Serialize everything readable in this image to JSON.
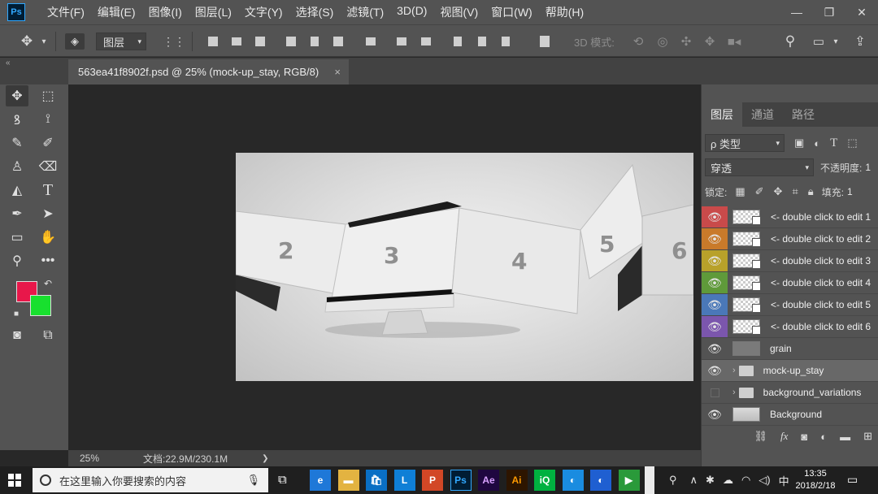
{
  "app": {
    "logo": "Ps"
  },
  "menu": [
    "文件(F)",
    "编辑(E)",
    "图像(I)",
    "图层(L)",
    "文字(Y)",
    "选择(S)",
    "滤镜(T)",
    "3D(D)",
    "视图(V)",
    "窗口(W)",
    "帮助(H)"
  ],
  "window_controls": {
    "minimize": "—",
    "restore": "❐",
    "close": "✕"
  },
  "options": {
    "auto_select_value": "图层",
    "mode_3d_label": "3D 模式:"
  },
  "document_tab": {
    "title": "563ea41f8902f.psd @ 25% (mock-up_stay, RGB/8)",
    "close": "×"
  },
  "colors": {
    "foreground": "#e8174a",
    "background": "#18e02e",
    "accent_selected_layer": "#686868"
  },
  "canvas": {
    "screens": [
      "2",
      "3",
      "4",
      "5",
      "6"
    ]
  },
  "status": {
    "zoom": "25%",
    "doc_size": "文档:22.9M/230.1M",
    "arrow": "❯"
  },
  "panel": {
    "tabs": [
      "图层",
      "通道",
      "路径"
    ],
    "filter_kind": "ρ 类型",
    "blend_mode": "穿透",
    "opacity_label": "不透明度:",
    "opacity_value": "1",
    "lock_label": "锁定:",
    "fill_label": "填充:",
    "fill_value": "1",
    "layers": [
      {
        "name": "<- double click to edit 1",
        "color": "#c94a4a",
        "thumb": "checker",
        "smart": true
      },
      {
        "name": "<- double click to edit 2",
        "color": "#c97a2a",
        "thumb": "checker",
        "smart": true
      },
      {
        "name": "<- double click to edit 3",
        "color": "#b8a12a",
        "thumb": "checker",
        "smart": true
      },
      {
        "name": "<- double click to edit 4",
        "color": "#5f9a3a",
        "thumb": "checker",
        "smart": true
      },
      {
        "name": "<- double click to edit 5",
        "color": "#4a78b8",
        "thumb": "checker",
        "smart": true
      },
      {
        "name": "<- double click to edit 6",
        "color": "#7b56ad",
        "thumb": "checker",
        "smart": true
      },
      {
        "name": "grain",
        "color": "",
        "thumb": "gray"
      },
      {
        "name": "mock-up_stay",
        "color": "",
        "group": true,
        "selected": true
      },
      {
        "name": "background_variations",
        "color": "",
        "group": true,
        "hidden": true
      },
      {
        "name": "Background",
        "color": "",
        "thumb": "bg"
      }
    ]
  },
  "taskbar": {
    "search_placeholder": "在这里输入你要搜索的内容",
    "time": "13:35",
    "date": "2018/2/18",
    "ime": "中",
    "apps": [
      {
        "label": "e",
        "color": "#1e78d8"
      },
      {
        "label": "▬",
        "color": "#e3b341"
      },
      {
        "label": "🛍",
        "color": "#0a6fc4"
      },
      {
        "label": "L",
        "color": "#0f7fd6"
      },
      {
        "label": "P",
        "color": "#d24726"
      },
      {
        "label": "Ps",
        "color": "#001d34"
      },
      {
        "label": "Ae",
        "color": "#1f0740"
      },
      {
        "label": "Ai",
        "color": "#2d1500"
      },
      {
        "label": "iQ",
        "color": "#00b140"
      },
      {
        "label": "◐",
        "color": "#1a8ce0"
      },
      {
        "label": "◐",
        "color": "#1f5fd1"
      },
      {
        "label": "▶",
        "color": "#2a9a3a"
      }
    ]
  }
}
